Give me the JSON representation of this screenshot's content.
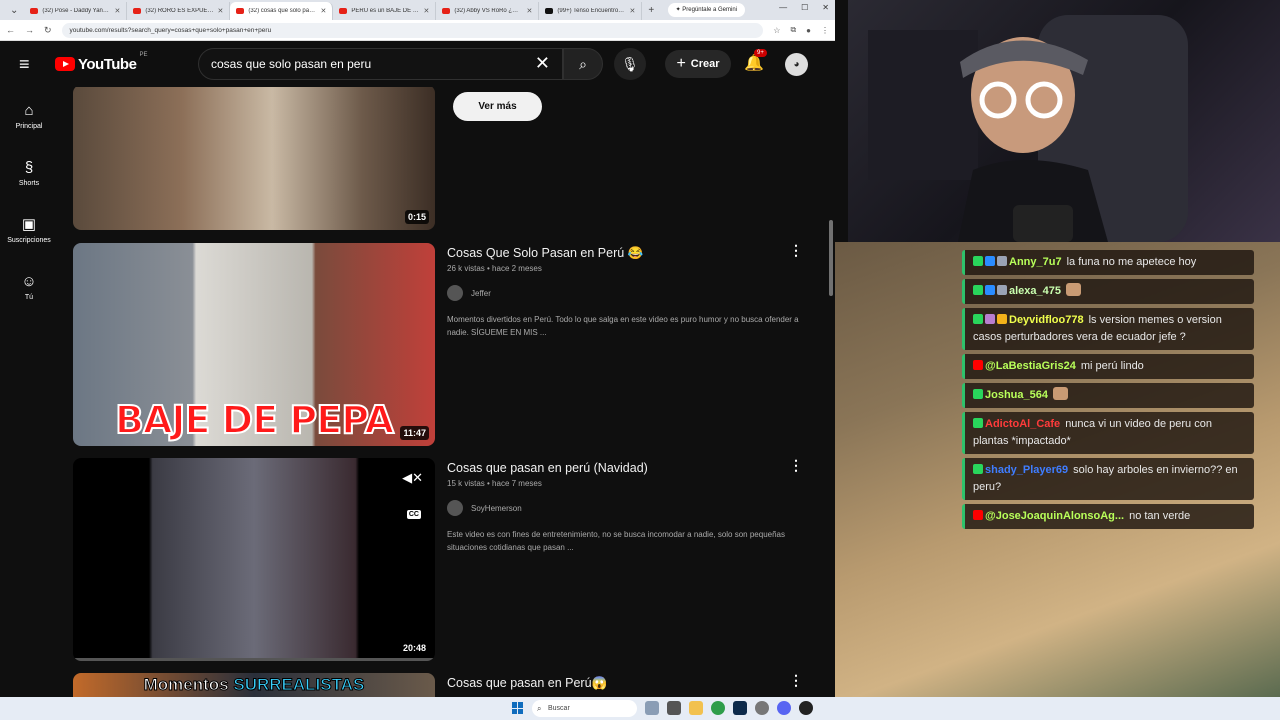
{
  "browser": {
    "tabs": [
      {
        "label": "(32) Pose - Daddy Yankee",
        "active": false,
        "icon": "youtube"
      },
      {
        "label": "(32) RORO ES EXPUESTA...",
        "active": false,
        "icon": "youtube"
      },
      {
        "label": "(32) cosas que solo pasan...",
        "active": true,
        "icon": "youtube"
      },
      {
        "label": "PERÚ es un BAJE DE PEPA",
        "active": false,
        "icon": "youtube"
      },
      {
        "label": "(32) Abby VS RoRo ¿Quién...",
        "active": false,
        "icon": "youtube"
      },
      {
        "label": "(99+) Tenso Encuentro en...",
        "active": false,
        "icon": "tiktok"
      }
    ],
    "gemini_label": "Pregúntale a Gemini",
    "url": "youtube.com/results?search_query=cosas+que+solo+pasan+en+peru"
  },
  "youtube": {
    "logo_text": "YouTube",
    "country_code": "PE",
    "search_query": "cosas que solo pasan en peru",
    "create_label": "Crear",
    "notification_count": "9+",
    "guide": [
      {
        "label": "Principal",
        "icon": "home-icon"
      },
      {
        "label": "Shorts",
        "icon": "shorts-icon"
      },
      {
        "label": "Suscripciones",
        "icon": "subscriptions-icon"
      },
      {
        "label": "Tú",
        "icon": "you-icon"
      }
    ],
    "ver_mas": "Ver más",
    "videos": [
      {
        "duration": "0:15"
      },
      {
        "title": "Cosas Que Solo Pasan en Perú 😂",
        "meta": "26 k vistas • hace 2 meses",
        "channel": "Jeffer",
        "description": "Momentos divertidos en Perú. Todo lo que salga en este video es puro humor y no busca ofender a nadie. SÍGUEME EN MIS ...",
        "duration": "11:47",
        "thumb_text": "BAJE DE PEPA"
      },
      {
        "title": "Cosas que pasan en perú (Navidad)",
        "meta": "15 k vistas • hace 7 meses",
        "channel": "SoyHemerson",
        "description": "Este video es con fines de entretenimiento, no se busca incomodar a nadie, solo son pequeñas situaciones cotidianas que pasan ...",
        "duration": "20:48",
        "cc_label": "CC",
        "progress": 0.0
      },
      {
        "title": "Cosas que pasan en Perú😱",
        "thumb_text_a": "Momentos ",
        "thumb_text_b": "SURREALISTAS"
      }
    ]
  },
  "taskbar": {
    "search_placeholder": "Buscar"
  },
  "chat": [
    {
      "user": "Anny_7u7",
      "color": "#b8ff5a",
      "badges": [
        "k",
        "blue",
        "gray"
      ],
      "text": "la funa no me apetece hoy"
    },
    {
      "user": "alexa_475",
      "color": "#c9ffb0",
      "badges": [
        "k",
        "blue",
        "gray"
      ],
      "text": "",
      "emote": true
    },
    {
      "user": "Deyvidfloo778",
      "color": "#f0ff4d",
      "badges": [
        "k",
        "pink",
        "gold"
      ],
      "text": "ls version memes o version casos perturbadores vera de ecuador jefe ?"
    },
    {
      "user": "@LaBestiaGris24",
      "color": "#b8ff5a",
      "badges": [
        "yt"
      ],
      "text": "mi perú lindo"
    },
    {
      "user": "Joshua_564",
      "color": "#b8ff5a",
      "badges": [
        "k"
      ],
      "text": "",
      "emote": true
    },
    {
      "user": "AdictoAl_Cafe",
      "color": "#ff3b3b",
      "badges": [
        "k"
      ],
      "text": "nunca vi un video de peru con plantas *impactado*"
    },
    {
      "user": "shady_Player69",
      "color": "#3f7dff",
      "badges": [
        "k"
      ],
      "text": "solo hay arboles en invierno?? en peru?"
    },
    {
      "user": "@JoseJoaquinAlonsoAg...",
      "color": "#b8ff5a",
      "badges": [
        "yt"
      ],
      "text": "no tan verde"
    }
  ],
  "colors": {
    "yt_red": "#ff0000",
    "yt_bg": "#0f0f0f",
    "chat_accent": "#2ec26b"
  }
}
